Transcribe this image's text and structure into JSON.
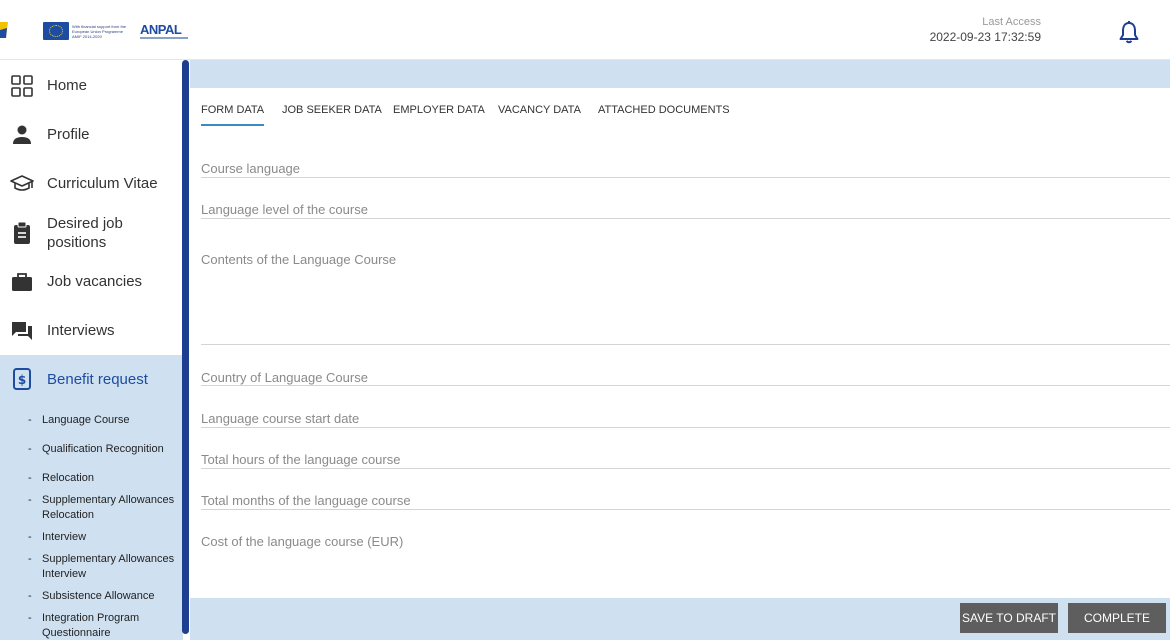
{
  "header": {
    "eu_text": "With financial support from the European Union Programme AMIF 2014-2020",
    "anpal_logo": "ANPAL",
    "last_access_label": "Last Access",
    "last_access_value": "2022-09-23 17:32:59"
  },
  "sidebar": {
    "items": [
      {
        "label": "Home",
        "icon": "grid-icon"
      },
      {
        "label": "Profile",
        "icon": "person-icon"
      },
      {
        "label": "Curriculum Vitae",
        "icon": "graduation-cap-icon"
      },
      {
        "label": "Desired job positions",
        "icon": "clipboard-icon"
      },
      {
        "label": "Job vacancies",
        "icon": "briefcase-icon"
      },
      {
        "label": "Interviews",
        "icon": "chat-icon"
      },
      {
        "label": "Benefit request",
        "icon": "dollar-document-icon"
      }
    ],
    "sub_items": [
      "Language Course",
      "Qualification Recognition",
      "Relocation",
      "Supplementary Allowances Relocation",
      "Interview",
      "Supplementary Allowances Interview",
      "Subsistence Allowance",
      "Integration Program Questionnaire"
    ]
  },
  "tabs": [
    "FORM DATA",
    "JOB SEEKER DATA",
    "EMPLOYER DATA",
    "VACANCY DATA",
    "ATTACHED DOCUMENTS"
  ],
  "form": {
    "fields": [
      "Course language",
      "Language level of the course",
      "Contents of the Language Course",
      "Country of Language Course",
      "Language course start date",
      "Total hours of the language course",
      "Total months of the language course",
      "Cost of the language course (EUR)"
    ]
  },
  "buttons": {
    "save_draft": "SAVE TO DRAFT",
    "complete": "COMPLETE"
  },
  "colors": {
    "accent_blue": "#1e4ca0",
    "light_blue": "#cfe1f1",
    "button_gray": "#5e5e5e",
    "tab_underline": "#3a8ac4"
  }
}
